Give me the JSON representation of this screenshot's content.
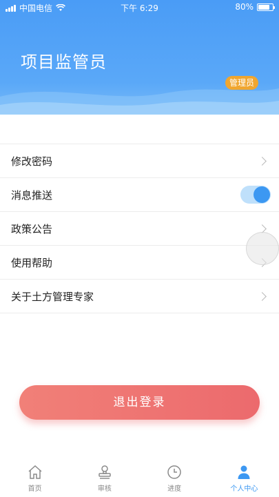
{
  "status_bar": {
    "carrier": "中国电信",
    "time": "下午 6:29",
    "battery_percent": "80%",
    "battery_level": 0.8
  },
  "header": {
    "title": "项目监管员",
    "role_badge": "管理员"
  },
  "menu": {
    "items": [
      {
        "label": "修改密码",
        "control": "chevron"
      },
      {
        "label": "消息推送",
        "control": "toggle",
        "toggle_on": true
      },
      {
        "label": "政策公告",
        "control": "chevron"
      },
      {
        "label": "使用帮助",
        "control": "chevron"
      },
      {
        "label": "关于土方管理专家",
        "control": "chevron"
      }
    ]
  },
  "logout_label": "退出登录",
  "tabbar": {
    "tabs": [
      {
        "label": "首页",
        "icon": "home-icon",
        "active": false
      },
      {
        "label": "审核",
        "icon": "stamp-icon",
        "active": false
      },
      {
        "label": "进度",
        "icon": "clock-icon",
        "active": false
      },
      {
        "label": "个人中心",
        "icon": "person-icon",
        "active": true
      }
    ]
  },
  "colors": {
    "header_blue": "#4a9cf6",
    "accent_blue": "#3c98f2",
    "badge_orange": "#f0a630",
    "logout_red": "#ec6a6d"
  }
}
